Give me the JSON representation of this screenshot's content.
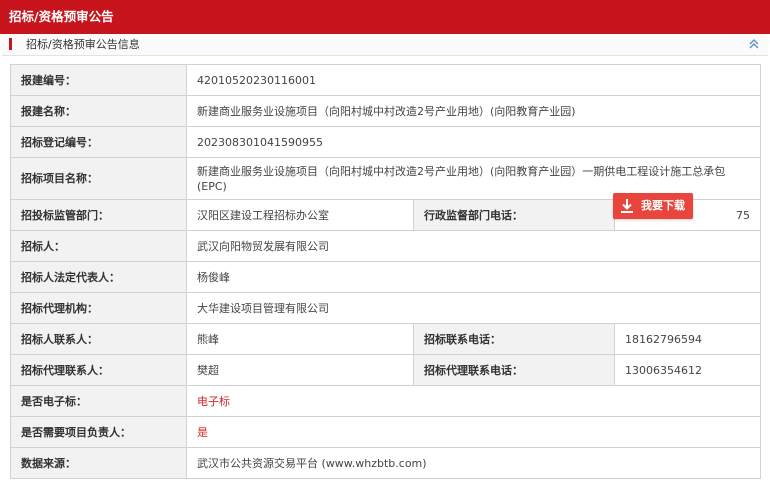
{
  "header": {
    "title": "招标/资格预审公告"
  },
  "section": {
    "title": "招标/资格预审公告信息"
  },
  "download_button": {
    "label": "我要下载"
  },
  "colors": {
    "brand_red": "#c8151d",
    "button_red": "#e8453c",
    "value_red": "#d7262c"
  },
  "fields": {
    "report_no_label": "报建编号：",
    "report_no": "42010520230116001",
    "report_name_label": "报建名称：",
    "report_name": "新建商业服务业设施项目（向阳村城中村改造2号产业用地）(向阳教育产业园)",
    "tender_reg_no_label": "招标登记编号：",
    "tender_reg_no": "202308301041590955",
    "tender_project_label": "招标项目名称：",
    "tender_project": "新建商业服务业设施项目（向阳村城中村改造2号产业用地）(向阳教育产业园）一期供电工程设计施工总承包(EPC)",
    "supervisor_label": "招投标监管部门：",
    "supervisor": "汉阳区建设工程招标办公室",
    "admin_phone_label": "行政监督部门电话：",
    "admin_phone_tail": "75",
    "tenderer_label": "招标人：",
    "tenderer": "武汉向阳物贸发展有限公司",
    "legal_rep_label": "招标人法定代表人：",
    "legal_rep": "杨俊峰",
    "agency_label": "招标代理机构：",
    "agency": "大华建设项目管理有限公司",
    "tenderer_contact_label": "招标人联系人：",
    "tenderer_contact": "熊峰",
    "tenderer_phone_label": "招标联系电话：",
    "tenderer_phone": "18162796594",
    "agency_contact_label": "招标代理联系人：",
    "agency_contact": "樊超",
    "agency_phone_label": "招标代理联系电话：",
    "agency_phone": "13006354612",
    "electronic_label": "是否电子标：",
    "electronic": "电子标",
    "need_manager_label": "是否需要项目负责人：",
    "need_manager": "是",
    "source_label": "数据来源：",
    "source": "武汉市公共资源交易平台 (www.whzbtb.com)"
  }
}
